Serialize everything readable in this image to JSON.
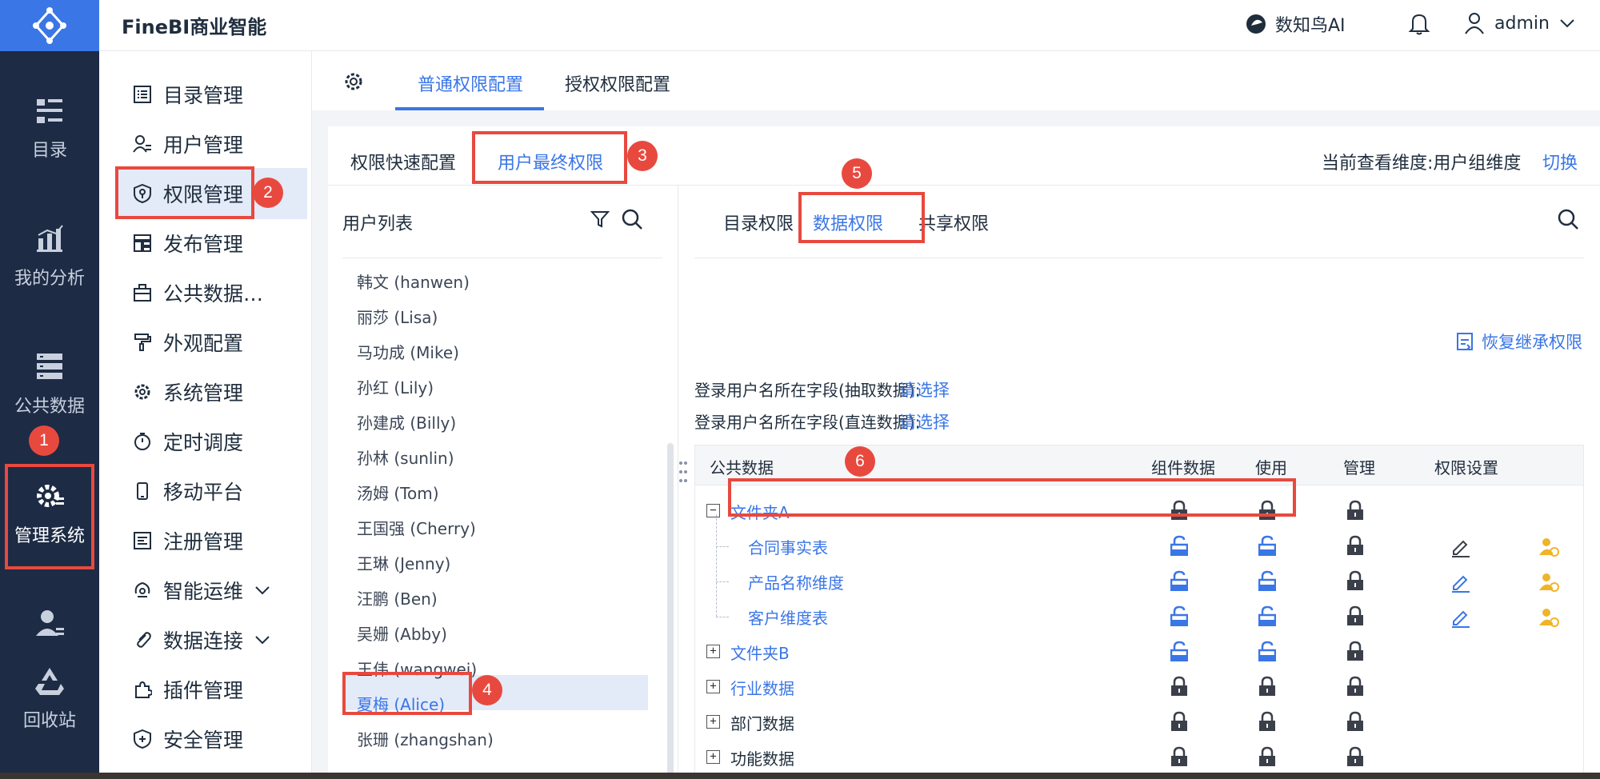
{
  "topbar": {
    "app_name": "FineBI商业智能",
    "ai_label": "数知鸟AI",
    "user_name": "admin"
  },
  "leftnav": {
    "items": [
      "目录",
      "我的分析",
      "公共数据",
      "管理系统",
      "回收站"
    ]
  },
  "submenu": {
    "items": [
      "目录管理",
      "用户管理",
      "权限管理",
      "发布管理",
      "公共数据…",
      "外观配置",
      "系统管理",
      "定时调度",
      "移动平台",
      "注册管理",
      "智能运维",
      "数据连接",
      "插件管理",
      "安全管理"
    ]
  },
  "content_tabs": {
    "items": [
      "普通权限配置",
      "授权权限配置"
    ]
  },
  "panel_tabs": {
    "items": [
      "权限快速配置",
      "用户最终权限"
    ]
  },
  "dimension": {
    "label": "当前查看维度:用户组维度",
    "switch": "切换"
  },
  "user_list": {
    "title": "用户列表",
    "users": [
      "韩文 (hanwen)",
      "丽莎 (Lisa)",
      "马功成 (Mike)",
      "孙红 (Lily)",
      "孙建成 (Billy)",
      "孙林 (sunlin)",
      "汤姆 (Tom)",
      "王国强 (Cherry)",
      "王琳 (Jenny)",
      "汪鹏 (Ben)",
      "吴姗 (Abby)",
      "王伟 (wangwei)",
      "夏梅 (Alice)",
      "张珊 (zhangshan)"
    ]
  },
  "perm_tabs": {
    "items": [
      "目录权限",
      "数据权限",
      "共享权限"
    ]
  },
  "restore_label": "恢复继承权限",
  "fields": [
    {
      "label": "登录用户名所在字段(抽取数据):",
      "value": "请选择"
    },
    {
      "label": "登录用户名所在字段(直连数据):",
      "value": "请选择"
    }
  ],
  "table": {
    "headers": [
      "公共数据",
      "组件数据",
      "使用",
      "管理",
      "权限设置"
    ],
    "rows": [
      {
        "name": "文件夹A",
        "exp": "−"
      },
      {
        "name": "合同事实表"
      },
      {
        "name": "产品名称维度"
      },
      {
        "name": "客户维度表"
      },
      {
        "name": "文件夹B",
        "exp": "+"
      },
      {
        "name": "行业数据",
        "exp": "+"
      },
      {
        "name": "部门数据",
        "exp": "+"
      },
      {
        "name": "功能数据",
        "exp": "+"
      }
    ]
  },
  "badges": [
    "1",
    "2",
    "3",
    "4",
    "5",
    "6"
  ],
  "colors": {
    "accent": "#3a76e6",
    "nav_bg": "#1d2b45",
    "highlight_red": "#e8493f",
    "lock_dark": "#3a3f4a",
    "user_icon": "#f0b429"
  }
}
